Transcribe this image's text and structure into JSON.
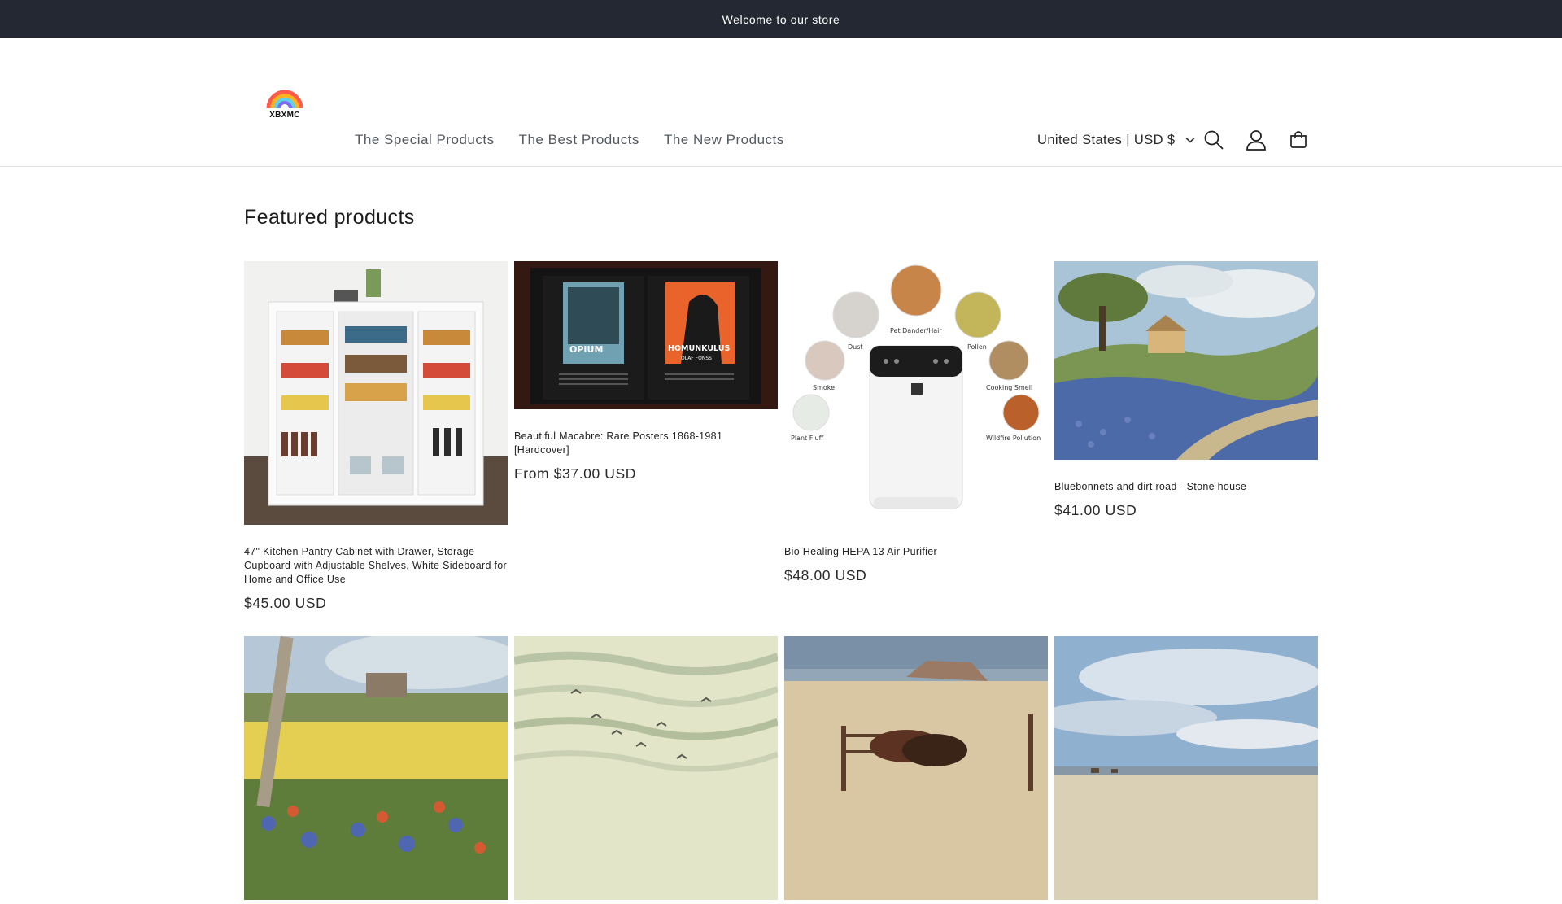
{
  "announcement": {
    "text": "Welcome to our store"
  },
  "header": {
    "logo_text": "XBXMC",
    "nav": [
      {
        "label": "The Special Products"
      },
      {
        "label": "The Best Products"
      },
      {
        "label": "The New Products"
      }
    ],
    "country_selector": "United States | USD $",
    "icons": [
      "search-icon",
      "account-icon",
      "cart-icon"
    ]
  },
  "featured": {
    "title": "Featured products",
    "products": [
      {
        "title": "47\" Kitchen Pantry Cabinet with Drawer, Storage Cupboard with Adjustable Shelves, White Sideboard for Home and Office Use",
        "price": "$45.00 USD"
      },
      {
        "title": "Beautiful Macabre: Rare Posters 1868-1981 [Hardcover]",
        "price": "From $37.00 USD"
      },
      {
        "title": "Bio Healing HEPA 13 Air Purifier",
        "price": "$48.00 USD"
      },
      {
        "title": "Bluebonnets and dirt road - Stone house",
        "price": "$41.00 USD"
      }
    ],
    "image_labels": {
      "poster_left": "OPIUM",
      "poster_right": "HOMUNKULUS",
      "poster_right_sub": "OLAF FONSS",
      "purifier": [
        "Pet Dander/Hair",
        "Dust",
        "Pollen",
        "Smoke",
        "Cooking Smell",
        "Plant Fluff",
        "Wildfire Pollution"
      ]
    }
  },
  "colors": {
    "announcement_bg": "#242833",
    "text": "#121212",
    "nav_text": "#555a63"
  }
}
